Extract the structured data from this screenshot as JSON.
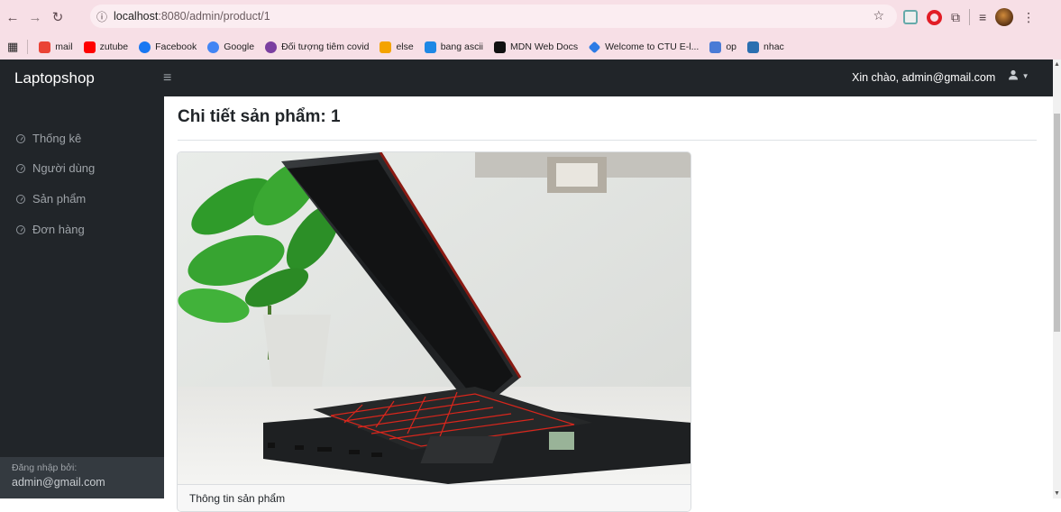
{
  "browser": {
    "url_host": "localhost",
    "url_path": ":8080/admin/product/1",
    "bookmarks": [
      {
        "label": "mail",
        "color": "#ea4335"
      },
      {
        "label": "zutube",
        "color": "#ff0000"
      },
      {
        "label": "Facebook",
        "color": "#1877f2"
      },
      {
        "label": "Google",
        "color": "#4285f4"
      },
      {
        "label": "Đối tượng tiêm covid",
        "color": "#7b3fa0"
      },
      {
        "label": "else",
        "color": "#f4a300"
      },
      {
        "label": "bang ascii",
        "color": "#1e88e5"
      },
      {
        "label": "MDN Web Docs",
        "color": "#111111"
      },
      {
        "label": "Welcome to CTU E-l...",
        "color": "#2c7be5"
      },
      {
        "label": "op",
        "color": "#4a7bd6"
      },
      {
        "label": "nhac",
        "color": "#2a6fb0"
      }
    ]
  },
  "navbar": {
    "brand": "Laptopshop",
    "greeting": "Xin chào, admin@gmail.com"
  },
  "sidebar": {
    "items": [
      {
        "label": "Thống kê"
      },
      {
        "label": "Người dùng"
      },
      {
        "label": "Sản phẩm"
      },
      {
        "label": "Đơn hàng"
      }
    ],
    "footer_label": "Đăng nhập bởi:",
    "footer_user": "admin@gmail.com"
  },
  "main": {
    "title": "Chi tiết sản phẩm: 1",
    "card_caption": "Thông tin sản phẩm"
  },
  "icons": {
    "back": "arrow-left-icon",
    "forward": "arrow-right-icon",
    "reload": "reload-icon",
    "user": "user-icon"
  }
}
